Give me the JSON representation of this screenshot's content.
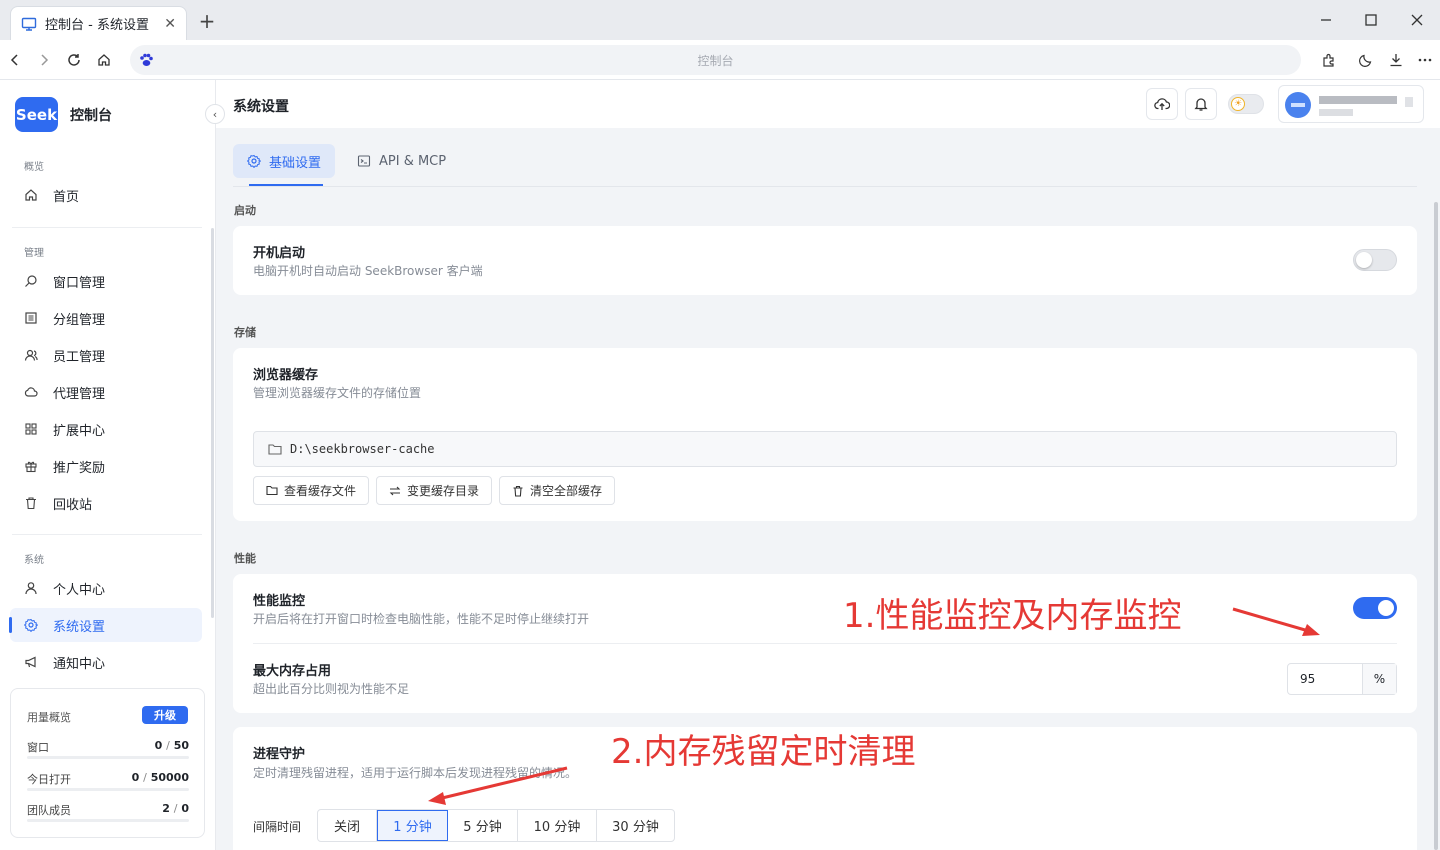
{
  "browser": {
    "tab_title": "控制台 - 系统设置",
    "address": "控制台"
  },
  "sidebar": {
    "brand_logo": "Seek",
    "brand_name": "控制台",
    "sections": {
      "overview": "概览",
      "manage": "管理",
      "system": "系统"
    },
    "items": {
      "home": "首页",
      "windows": "窗口管理",
      "groups": "分组管理",
      "staff": "员工管理",
      "proxy": "代理管理",
      "extensions": "扩展中心",
      "referral": "推广奖励",
      "recycle": "回收站",
      "profile": "个人中心",
      "settings": "系统设置",
      "notifications": "通知中心"
    },
    "usage": {
      "title": "用量概览",
      "upgrade": "升级",
      "rows": [
        {
          "label": "窗口",
          "used": "0",
          "total": "50"
        },
        {
          "label": "今日打开",
          "used": "0",
          "total": "50000"
        },
        {
          "label": "团队成员",
          "used": "2",
          "total": "0"
        }
      ]
    }
  },
  "header": {
    "title": "系统设置"
  },
  "tabs": {
    "basic": "基础设置",
    "api": "API & MCP"
  },
  "settings": {
    "startup": {
      "group": "启动",
      "title": "开机启动",
      "desc": "电脑开机时自动启动 SeekBrowser 客户端",
      "enabled": false
    },
    "storage": {
      "group": "存储",
      "title": "浏览器缓存",
      "desc": "管理浏览器缓存文件的存储位置",
      "path": "D:\\seekbrowser-cache",
      "btn_view": "查看缓存文件",
      "btn_change": "变更缓存目录",
      "btn_clear": "清空全部缓存"
    },
    "performance": {
      "group": "性能",
      "monitor_title": "性能监控",
      "monitor_desc": "开启后将在打开窗口时检查电脑性能，性能不足时停止继续打开",
      "monitor_enabled": true,
      "memory_title": "最大内存占用",
      "memory_desc": "超出此百分比则视为性能不足",
      "memory_value": "95",
      "memory_unit": "%"
    },
    "guard": {
      "title": "进程守护",
      "desc": "定时清理残留进程，适用于运行脚本后发现进程残留的情况。",
      "interval_label": "间隔时间",
      "options": [
        "关闭",
        "1 分钟",
        "5 分钟",
        "10 分钟",
        "30 分钟"
      ],
      "selected": "1 分钟"
    }
  },
  "annotations": {
    "a1": "1.性能监控及内存监控",
    "a2": "2.内存残留定时清理"
  },
  "colors": {
    "accent": "#2f6bf0",
    "annotation": "#e53935"
  }
}
